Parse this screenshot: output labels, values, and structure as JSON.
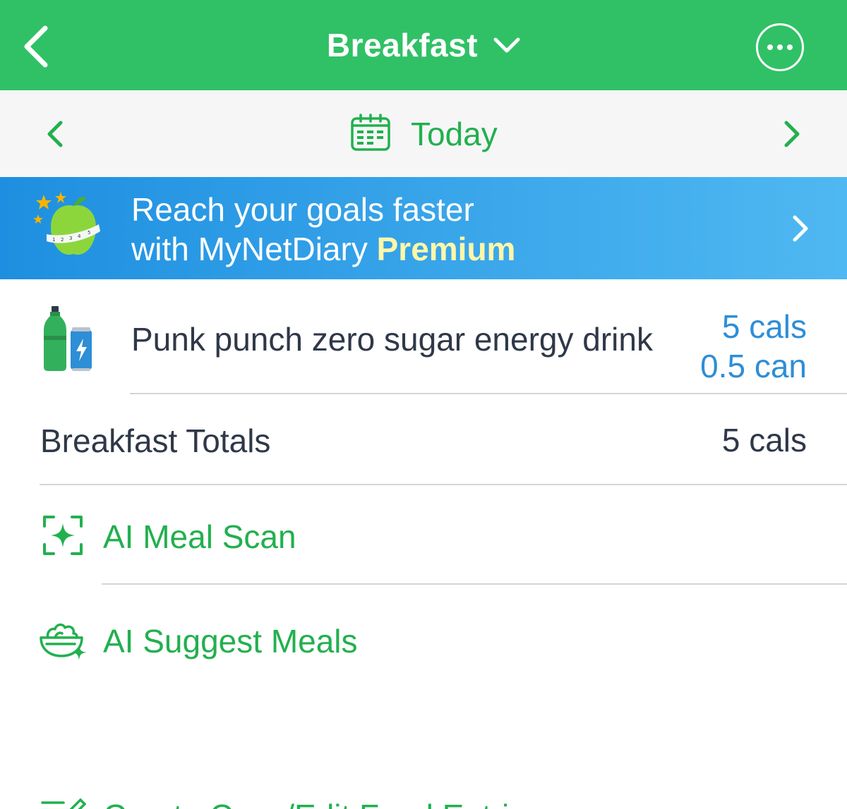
{
  "header": {
    "title": "Breakfast",
    "bg_color": "#30c166",
    "back_icon": "chevron-left-icon",
    "more_icon": "more-horizontal-icon"
  },
  "date_bar": {
    "label": "Today",
    "accent_color": "#22b04f",
    "icon": "calendar-icon"
  },
  "banner": {
    "line1": "Reach your goals faster",
    "line2_prefix": "with MyNetDiary ",
    "line2_highlight": "Premium",
    "icon": "apple-measuring-tape-icon"
  },
  "entries": [
    {
      "name": "Punk punch zero sugar energy drink",
      "calories": "5 cals",
      "quantity": "0.5 can",
      "icon": "drinks-icon"
    }
  ],
  "totals": {
    "label": "Breakfast Totals",
    "value": "5 cals"
  },
  "actions": {
    "ai_meal_scan": "AI Meal Scan",
    "ai_suggest_meals": "AI Suggest Meals",
    "partial": "Create Copy/Edit Food Entries"
  }
}
